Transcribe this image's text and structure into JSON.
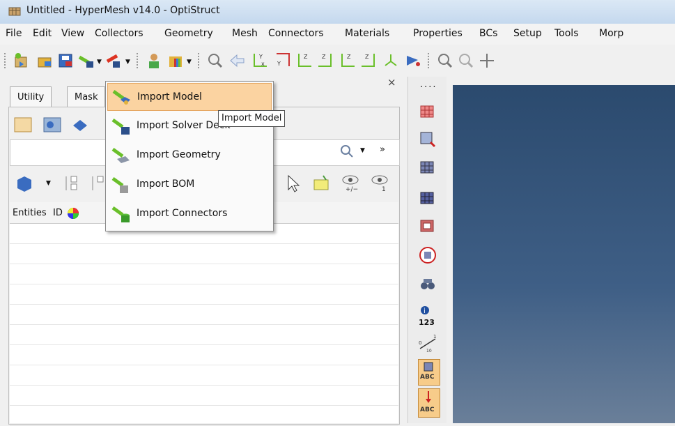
{
  "window": {
    "title": "Untitled - HyperMesh v14.0 - OptiStruct"
  },
  "menubar": {
    "items": [
      "File",
      "Edit",
      "View",
      "Collectors",
      "Geometry",
      "Mesh",
      "Connectors",
      "Materials",
      "Properties",
      "BCs",
      "Setup",
      "Tools",
      "Morp"
    ]
  },
  "panel": {
    "tabs": [
      "Utility",
      "Mask"
    ],
    "close_glyph": "×",
    "search_placeholder": "",
    "list_header": {
      "entities": "Entities",
      "id": "ID"
    }
  },
  "import_menu": {
    "items": [
      "Import Model",
      "Import Solver Deck",
      "Import Geometry",
      "Import BOM",
      "Import Connectors"
    ],
    "highlighted_index": 0
  },
  "tooltip": {
    "text": "Import Model"
  },
  "right_strip": {
    "info_label": "123",
    "abc_label": "ABC",
    "scale_top": "1",
    "scale_bottom": "0",
    "scale_mid": "10"
  },
  "colors": {
    "viewport": "#3f5f86",
    "menu_highlight": "#fbd3a1",
    "accent_green": "#6abf2a"
  }
}
